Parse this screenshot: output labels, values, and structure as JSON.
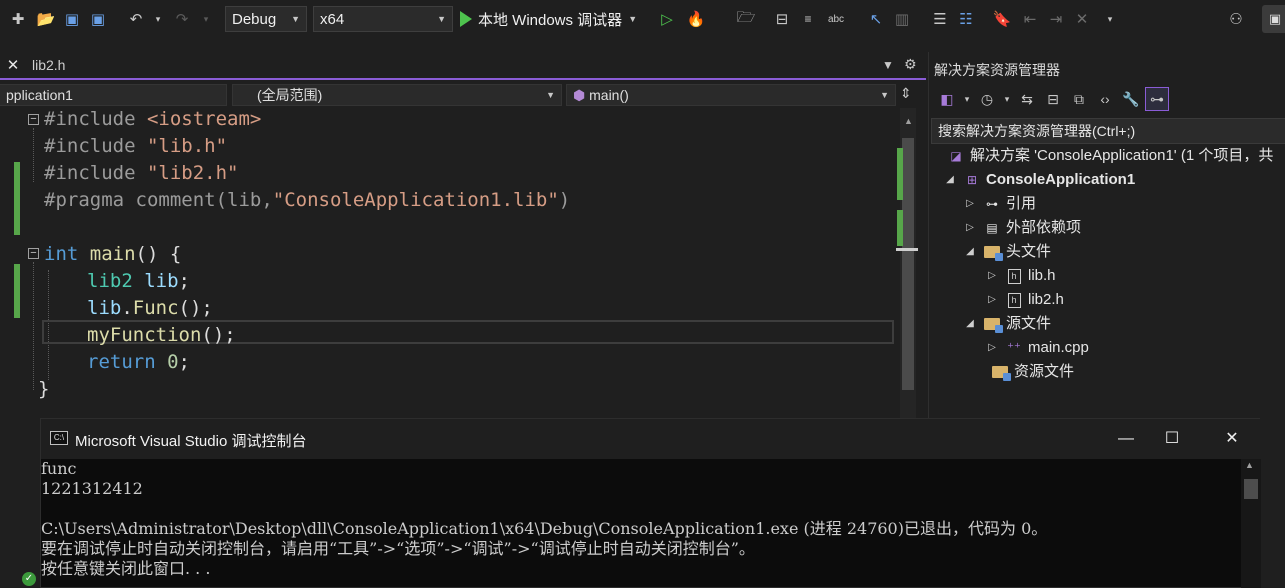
{
  "toolbar": {
    "config": "Debug",
    "platform": "x64",
    "run_label": "本地 Windows 调试器"
  },
  "tabs": [
    {
      "label": "lib2.h"
    }
  ],
  "navbar": {
    "project": "pplication1",
    "scope": "(全局范围)",
    "member": "main()"
  },
  "code": {
    "l1_kw": "#include",
    "l1_rest": " <iostream>",
    "l2_kw": "#include",
    "l2_rest": " \"lib.h\"",
    "l3_kw": "#include",
    "l3_rest": " \"lib2.h\"",
    "l4_kw": "#pragma",
    "l4_mid": " comment(lib,",
    "l4_str": "\"ConsoleApplication1.lib\"",
    "l4_end": ")",
    "l6_kw": "int",
    "l6_fn": " main",
    "l6_rest": "() {",
    "l7_ty": "lib2",
    "l7_var": " lib",
    "l7_end": ";",
    "l8_var": "lib",
    "l8_dot": ".",
    "l8_fn": "Func",
    "l8_end": "();",
    "l9_fn": "myFunction",
    "l9_end": "();",
    "l10_kw": "return",
    "l10_num": " 0",
    "l10_end": ";",
    "l11": "}"
  },
  "solution_explorer": {
    "title": "解决方案资源管理器",
    "search_placeholder": "搜索解决方案资源管理器(Ctrl+;)",
    "solution_label": "解决方案 'ConsoleApplication1' (1 个项目，共",
    "project_label": "ConsoleApplication1",
    "references": "引用",
    "external_deps": "外部依赖项",
    "header_files": "头文件",
    "lib_h": "lib.h",
    "lib2_h": "lib2.h",
    "source_files": "源文件",
    "main_cpp": "main.cpp",
    "resource_files": "资源文件"
  },
  "console": {
    "title": "Microsoft Visual Studio 调试控制台",
    "lines": [
      "func",
      "1221312412",
      "",
      "C:\\Users\\Administrator\\Desktop\\dll\\ConsoleApplication1\\x64\\Debug\\ConsoleApplication1.exe (进程 24760)已退出，代码为 0。",
      "要在调试停止时自动关闭控制台，请启用“工具”->“选项”->“调试”->“调试停止时自动关闭控制台”。",
      "按任意键关闭此窗口. . ."
    ]
  }
}
